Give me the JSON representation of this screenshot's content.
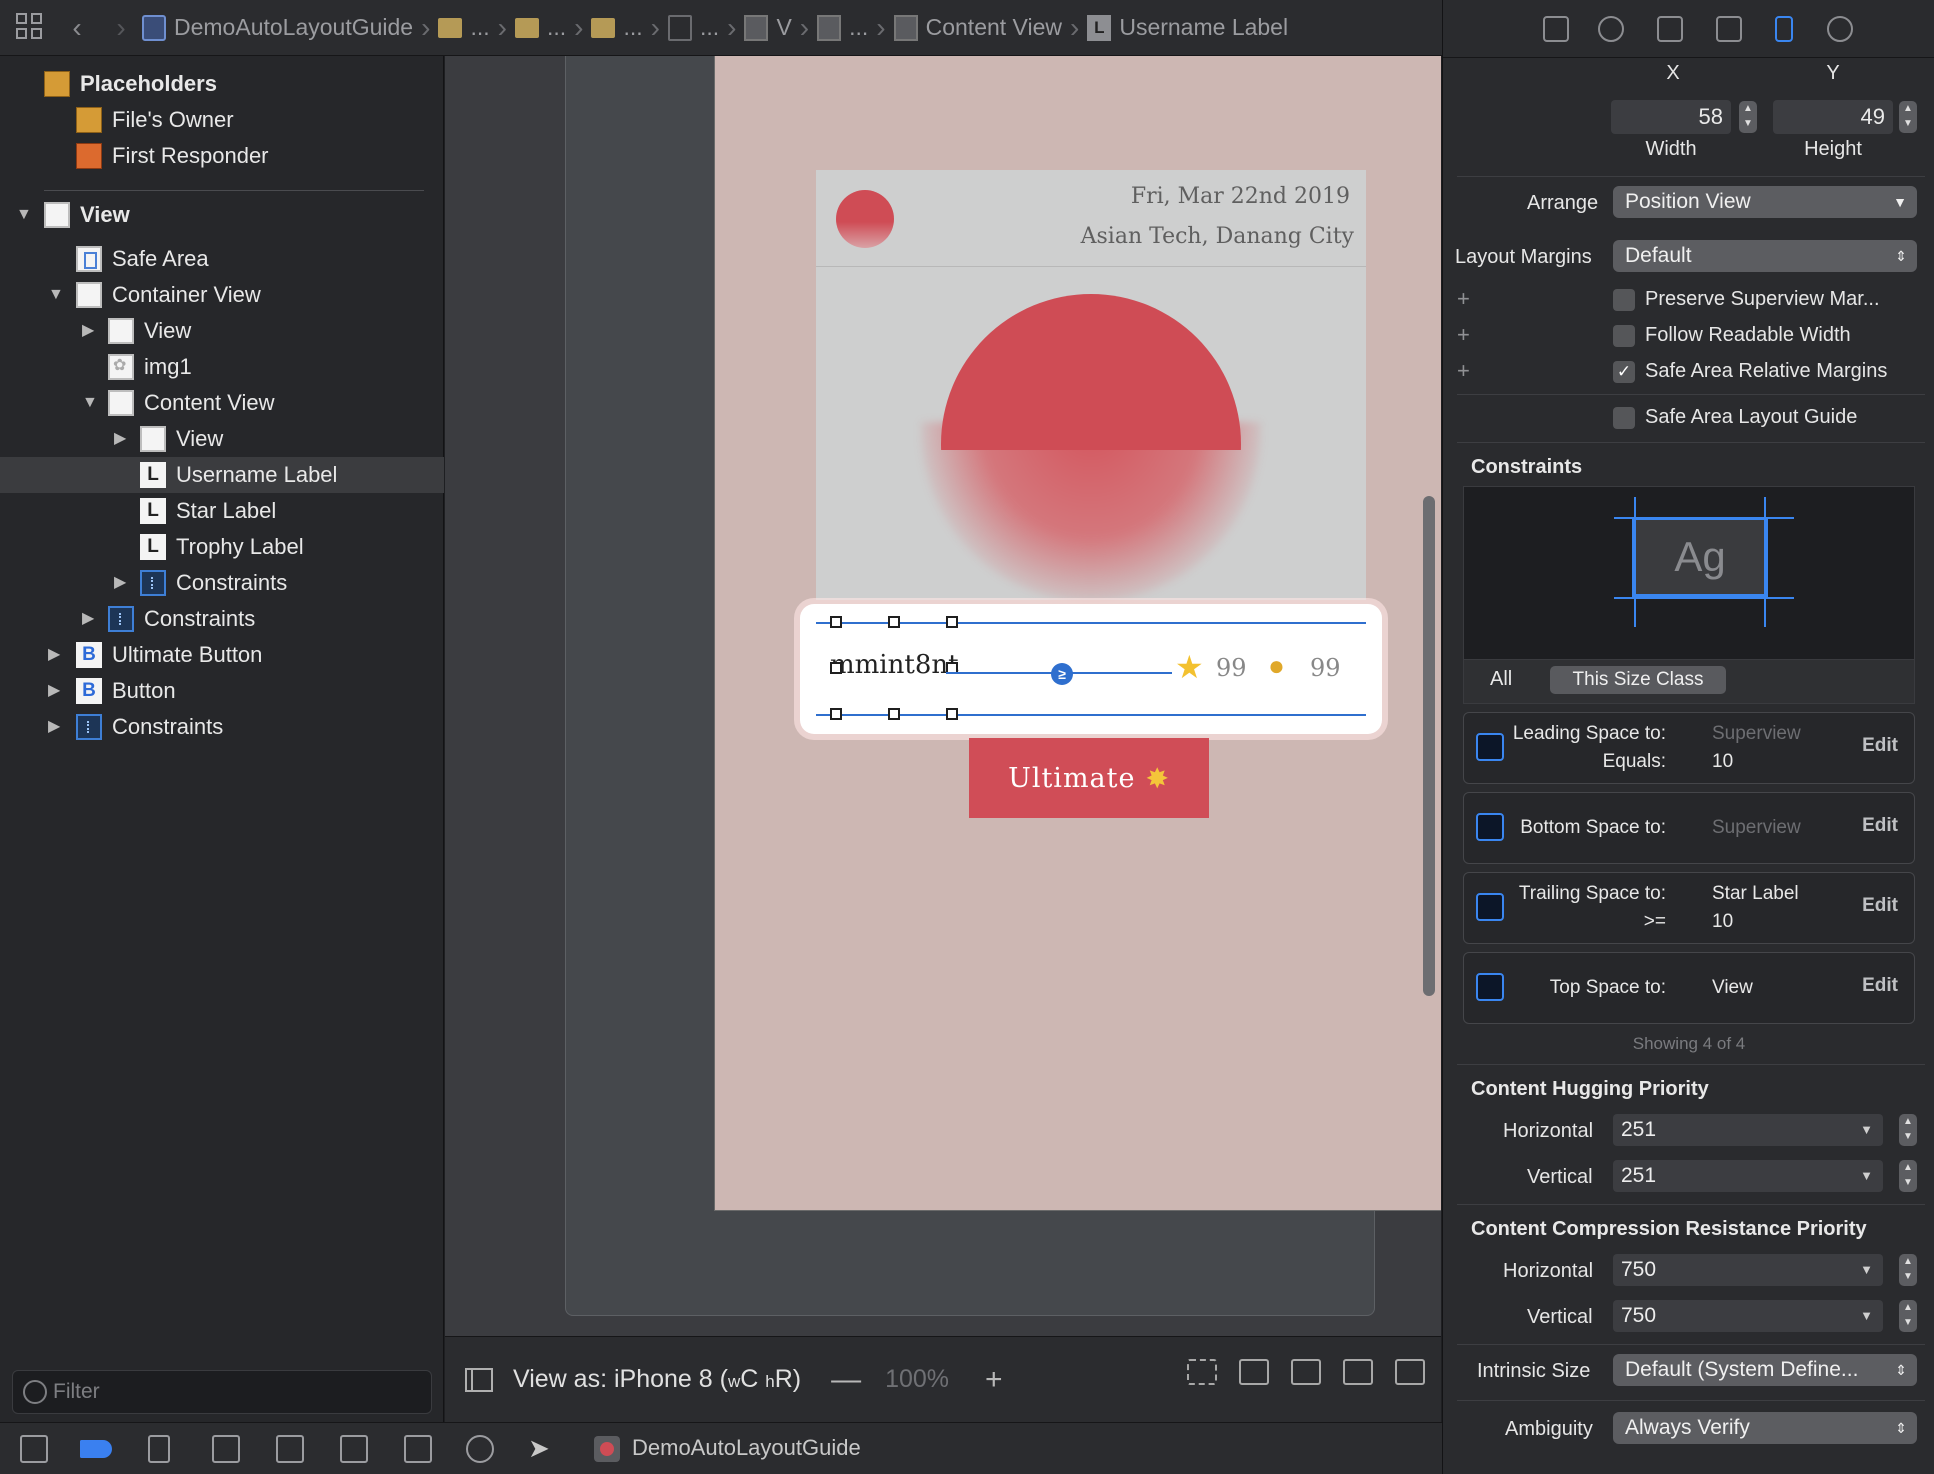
{
  "jumpbar": {
    "crumbs": [
      {
        "icon": "storyboard-file-icon",
        "label": "DemoAutoLayoutGuide"
      },
      {
        "icon": "folder-icon",
        "label": "..."
      },
      {
        "icon": "folder-icon",
        "label": "..."
      },
      {
        "icon": "folder-icon",
        "label": "..."
      },
      {
        "icon": "xib-icon",
        "label": "..."
      },
      {
        "icon": "view-icon",
        "label": "V"
      },
      {
        "icon": "view-icon",
        "label": "..."
      },
      {
        "icon": "view-icon",
        "label": "Content View"
      },
      {
        "icon": "label-icon",
        "label": "Username Label"
      }
    ]
  },
  "outline": {
    "placeholders_label": "Placeholders",
    "files_owner": "File's Owner",
    "first_responder": "First Responder",
    "view": "View",
    "safe_area": "Safe Area",
    "container_view": "Container View",
    "container_subview": "View",
    "img1": "img1",
    "content_view": "Content View",
    "content_subview": "View",
    "username_label": "Username Label",
    "star_label": "Star Label",
    "trophy_label": "Trophy Label",
    "content_constraints": "Constraints",
    "container_constraints": "Constraints",
    "ultimate_button": "Ultimate Button",
    "button": "Button",
    "root_constraints": "Constraints",
    "filter_placeholder": "Filter"
  },
  "canvas": {
    "date": "Fri, Mar 22nd 2019",
    "place": "Asian Tech, Danang City",
    "username": "mmint8nt",
    "constraint_badge": "≥",
    "star_value": "99",
    "trophy_value": "99",
    "ultimate_label": "Ultimate",
    "colors": {
      "accent_red": "#cf4c55",
      "background": "#cdb7b3",
      "card": "#cecfcf",
      "selection_blue": "#2f6fce"
    }
  },
  "canvasbar": {
    "view_as": "View as: iPhone 8 (",
    "w_sub": "w",
    "w_val": "C ",
    "h_sub": "h",
    "h_val": "R)",
    "zoom_minus": "—",
    "zoom": "100%",
    "zoom_plus": "+"
  },
  "inspector": {
    "x_label": "X",
    "y_label": "Y",
    "width_value": "58",
    "height_value": "49",
    "width_label": "Width",
    "height_label": "Height",
    "arrange_label": "Arrange",
    "arrange_value": "Position View",
    "layout_margins_label": "Layout Margins",
    "layout_margins_value": "Default",
    "checkboxes": [
      {
        "label": "Preserve Superview Mar...",
        "checked": false
      },
      {
        "label": "Follow Readable Width",
        "checked": false
      },
      {
        "label": "Safe Area Relative Margins",
        "checked": true
      },
      {
        "label": "Safe Area Layout Guide",
        "checked": false
      }
    ],
    "constraints_header": "Constraints",
    "ag_text": "Ag",
    "size_class_all": "All",
    "size_class_this": "This Size Class",
    "constraint_rows": [
      {
        "key1": "Leading Space to:",
        "val1": "Superview",
        "val1_dim": true,
        "key2": "Equals:",
        "val2": "10",
        "edit": "Edit"
      },
      {
        "key1": "Bottom Space to:",
        "val1": "Superview",
        "val1_dim": true,
        "edit": "Edit"
      },
      {
        "key1": "Trailing Space to:",
        "val1": "Star Label",
        "val1_dim": false,
        "key2": ">=",
        "val2": "10",
        "edit": "Edit"
      },
      {
        "key1": "Top Space to:",
        "val1": "View",
        "val1_dim": false,
        "edit": "Edit"
      }
    ],
    "showing": "Showing 4 of 4",
    "hugging_header": "Content Hugging Priority",
    "hugging_h_label": "Horizontal",
    "hugging_h": "251",
    "hugging_v_label": "Vertical",
    "hugging_v": "251",
    "compression_header": "Content Compression Resistance Priority",
    "compression_h_label": "Horizontal",
    "compression_h": "750",
    "compression_v_label": "Vertical",
    "compression_v": "750",
    "intrinsic_label": "Intrinsic Size",
    "intrinsic_value": "Default (System Define...",
    "ambiguity_label": "Ambiguity",
    "ambiguity_value": "Always Verify"
  },
  "debugbar": {
    "scheme_name": "DemoAutoLayoutGuide"
  }
}
